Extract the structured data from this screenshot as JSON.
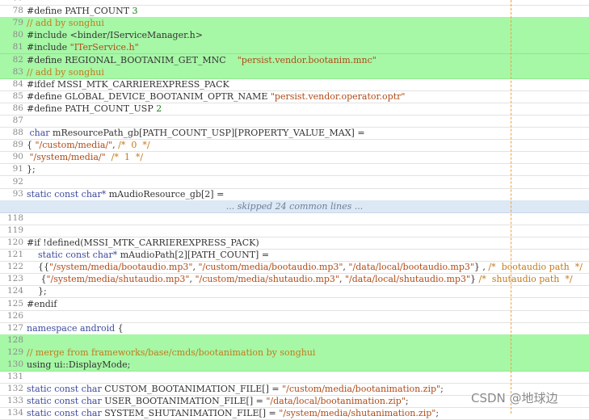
{
  "watermark": "CSDN @地球边",
  "lines": [
    {
      "num": "77",
      "type": "normal",
      "code": []
    },
    {
      "num": "78",
      "type": "normal",
      "code": [
        [
          "#define PATH_COUNT ",
          ""
        ],
        [
          "3",
          "num"
        ]
      ]
    },
    {
      "num": "79",
      "type": "added",
      "code": [
        [
          "// add by songhui",
          "cmt"
        ]
      ]
    },
    {
      "num": "80",
      "type": "added",
      "code": [
        [
          "#include <binder/IServiceManager.h>",
          ""
        ]
      ]
    },
    {
      "num": "81",
      "type": "added",
      "code": [
        [
          "#include ",
          ""
        ],
        [
          "\"ITerService.h\"",
          "str"
        ]
      ]
    },
    {
      "num": "82",
      "type": "added",
      "code": [
        [
          "#define REGIONAL_BOOTANIM_GET_MNC    ",
          ""
        ],
        [
          "\"persist.vendor.bootanim.mnc\"",
          "str"
        ]
      ]
    },
    {
      "num": "83",
      "type": "added",
      "code": [
        [
          "// add by songhui",
          "cmt"
        ]
      ]
    },
    {
      "num": "84",
      "type": "normal",
      "code": [
        [
          "#ifdef MSSI_MTK_CARRIEREXPRESS_PACK",
          ""
        ]
      ]
    },
    {
      "num": "85",
      "type": "normal",
      "code": [
        [
          "#define GLOBAL_DEVICE_BOOTANIM_OPTR_NAME ",
          ""
        ],
        [
          "\"persist.vendor.operator.optr\"",
          "str"
        ]
      ]
    },
    {
      "num": "86",
      "type": "normal",
      "code": [
        [
          "#define PATH_COUNT_USP ",
          ""
        ],
        [
          "2",
          "num"
        ]
      ]
    },
    {
      "num": "87",
      "type": "normal",
      "code": []
    },
    {
      "num": "88",
      "type": "normal",
      "code": [
        [
          " ",
          ""
        ],
        [
          "char",
          "kw"
        ],
        [
          " mResourcePath_gb[PATH_COUNT_USP][PROPERTY_VALUE_MAX] =",
          ""
        ]
      ]
    },
    {
      "num": "89",
      "type": "normal",
      "code": [
        [
          "{ ",
          ""
        ],
        [
          "\"/custom/media/\"",
          "str"
        ],
        [
          ", ",
          ""
        ],
        [
          "/*  0  */",
          "cmt"
        ]
      ]
    },
    {
      "num": "90",
      "type": "normal",
      "code": [
        [
          " ",
          ""
        ],
        [
          "\"/system/media/\"",
          "str"
        ],
        [
          "  ",
          ""
        ],
        [
          "/*  1  */",
          "cmt"
        ]
      ]
    },
    {
      "num": "91",
      "type": "normal",
      "code": [
        [
          "};",
          ""
        ]
      ]
    },
    {
      "num": "92",
      "type": "normal",
      "code": []
    },
    {
      "num": "93",
      "type": "normal",
      "code": [
        [
          "static const ",
          "kw"
        ],
        [
          "char*",
          "kw"
        ],
        [
          " mAudioResource_gb[2] =",
          ""
        ]
      ]
    },
    {
      "num": "",
      "type": "skip",
      "code": [
        [
          "... skipped 24 common lines ...",
          ""
        ]
      ]
    },
    {
      "num": "118",
      "type": "normal",
      "code": []
    },
    {
      "num": "119",
      "type": "normal",
      "code": []
    },
    {
      "num": "120",
      "type": "normal",
      "code": [
        [
          "#if !defined(MSSI_MTK_CARRIEREXPRESS_PACK)",
          ""
        ]
      ]
    },
    {
      "num": "121",
      "type": "normal",
      "code": [
        [
          "    ",
          ""
        ],
        [
          "static const ",
          "kw"
        ],
        [
          "char*",
          "kw"
        ],
        [
          " mAudioPath[2][PATH_COUNT] =",
          ""
        ]
      ]
    },
    {
      "num": "122",
      "type": "normal",
      "code": [
        [
          "    {{",
          ""
        ],
        [
          "\"/system/media/bootaudio.mp3\"",
          "str"
        ],
        [
          ", ",
          ""
        ],
        [
          "\"/custom/media/bootaudio.mp3\"",
          "str"
        ],
        [
          ", ",
          ""
        ],
        [
          "\"/data/local/bootaudio.mp3\"",
          "str"
        ],
        [
          "} , ",
          ""
        ],
        [
          "/*  bootaudio path  */",
          "cmt"
        ]
      ]
    },
    {
      "num": "123",
      "type": "normal",
      "code": [
        [
          "     {",
          ""
        ],
        [
          "\"/system/media/shutaudio.mp3\"",
          "str"
        ],
        [
          ", ",
          ""
        ],
        [
          "\"/custom/media/shutaudio.mp3\"",
          "str"
        ],
        [
          ", ",
          ""
        ],
        [
          "\"/data/local/shutaudio.mp3\"",
          "str"
        ],
        [
          "} ",
          ""
        ],
        [
          "/*  shutaudio path  */",
          "cmt"
        ]
      ]
    },
    {
      "num": "124",
      "type": "normal",
      "code": [
        [
          "    };",
          ""
        ]
      ]
    },
    {
      "num": "125",
      "type": "normal",
      "code": [
        [
          "#endif",
          ""
        ]
      ]
    },
    {
      "num": "126",
      "type": "normal",
      "code": []
    },
    {
      "num": "127",
      "type": "normal",
      "code": [
        [
          "namespace ",
          "kw"
        ],
        [
          "android",
          "kw"
        ],
        [
          " {",
          ""
        ]
      ]
    },
    {
      "num": "128",
      "type": "added",
      "code": []
    },
    {
      "num": "129",
      "type": "added",
      "code": [
        [
          "// merge from frameworks/base/cmds/bootanimation by songhui",
          "cmt"
        ]
      ]
    },
    {
      "num": "130",
      "type": "added",
      "code": [
        [
          "using ui::DisplayMode;",
          ""
        ]
      ]
    },
    {
      "num": "131",
      "type": "normal",
      "code": []
    },
    {
      "num": "132",
      "type": "normal",
      "code": [
        [
          "static const ",
          "kw"
        ],
        [
          "char",
          "kw"
        ],
        [
          " CUSTOM_BOOTANIMATION_FILE[] = ",
          ""
        ],
        [
          "\"/custom/media/bootanimation.zip\"",
          "str"
        ],
        [
          ";",
          ""
        ]
      ]
    },
    {
      "num": "133",
      "type": "normal",
      "code": [
        [
          "static const ",
          "kw"
        ],
        [
          "char",
          "kw"
        ],
        [
          " USER_BOOTANIMATION_FILE[] = ",
          ""
        ],
        [
          "\"/data/local/bootanimation.zip\"",
          "str"
        ],
        [
          ";",
          ""
        ]
      ]
    },
    {
      "num": "134",
      "type": "normal",
      "code": [
        [
          "static const ",
          "kw"
        ],
        [
          "char",
          "kw"
        ],
        [
          " SYSTEM_SHUTANIMATION_FILE[] = ",
          ""
        ],
        [
          "\"/system/media/shutanimation.zip\"",
          "str"
        ],
        [
          ";",
          ""
        ]
      ]
    }
  ]
}
